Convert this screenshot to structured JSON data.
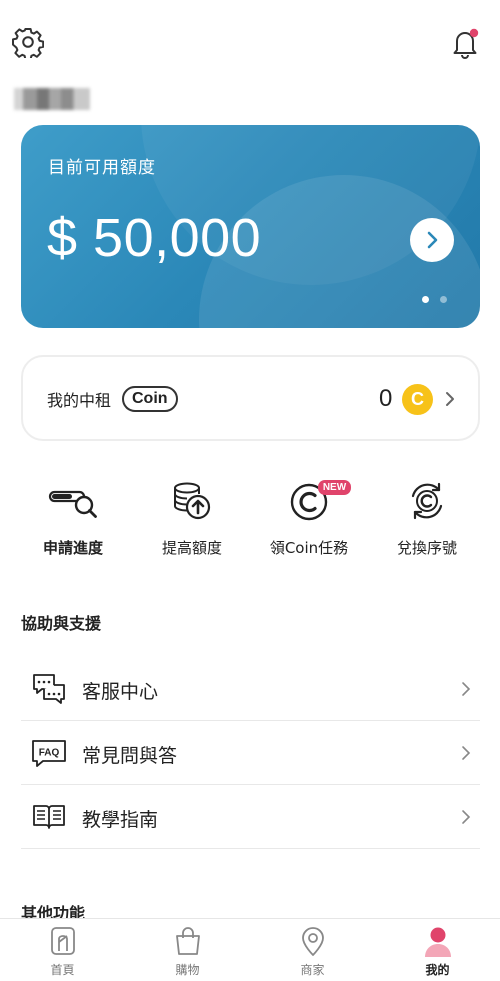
{
  "header": {
    "settings_icon": "gear-icon",
    "notification_icon": "bell-icon",
    "notification_dot_color": "#e0446b"
  },
  "credit_card": {
    "label": "目前可用額度",
    "amount": "$ 50,000",
    "bg_color": "#2b88b8"
  },
  "coin_box": {
    "label": "我的中租",
    "pill": "Coin",
    "count": "0",
    "coin_glyph": "C",
    "coin_color": "#f7c219"
  },
  "actions": [
    {
      "label": "申請進度",
      "icon": "progress-search-icon"
    },
    {
      "label": "提高額度",
      "icon": "coins-upload-icon"
    },
    {
      "label": "領Coin任務",
      "icon": "coin-mission-icon",
      "badge": "NEW"
    },
    {
      "label": "兌換序號",
      "icon": "coin-exchange-icon"
    }
  ],
  "support": {
    "title": "協助與支援",
    "items": [
      {
        "label": "客服中心",
        "icon": "chat-bubbles-icon"
      },
      {
        "label": "常見問與答",
        "icon": "faq-icon"
      },
      {
        "label": "教學指南",
        "icon": "book-icon"
      }
    ]
  },
  "other": {
    "title": "其他功能"
  },
  "tabbar": {
    "items": [
      {
        "label": "首頁",
        "icon": "home-icon"
      },
      {
        "label": "購物",
        "icon": "shopping-bag-icon"
      },
      {
        "label": "商家",
        "icon": "location-pin-icon"
      },
      {
        "label": "我的",
        "icon": "profile-icon",
        "active": true
      }
    ],
    "active_color": "#e0446b"
  }
}
